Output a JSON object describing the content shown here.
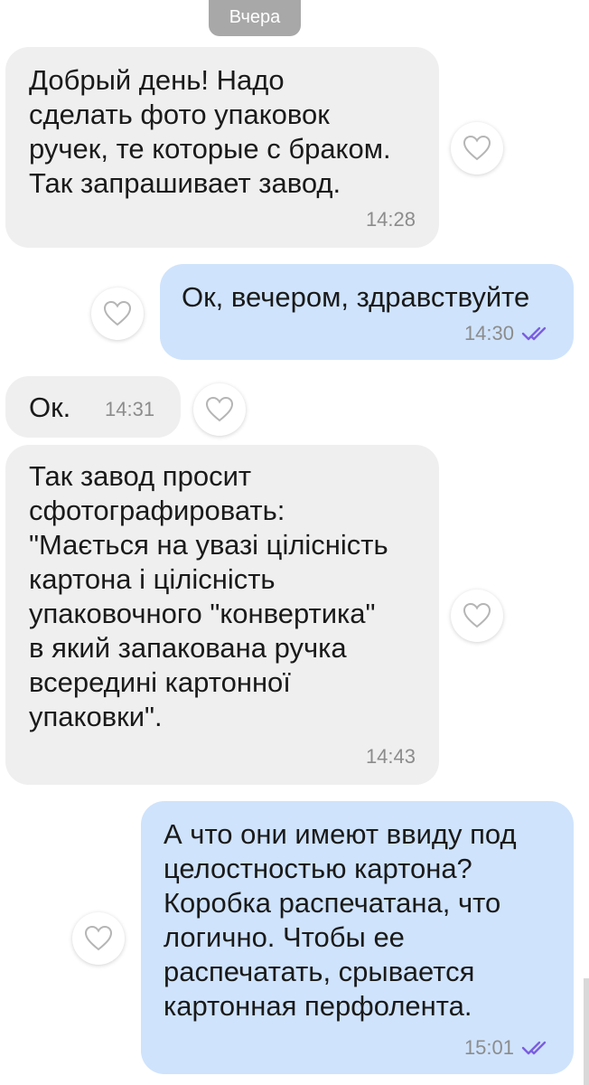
{
  "date_separator": "Вчера",
  "messages": [
    {
      "direction": "incoming",
      "text": "Добрый день! Надо\nсделать фото упаковок\nручек, те которые с браком.\nТак запрашивает завод.",
      "time": "14:28",
      "icon": "heart-outline"
    },
    {
      "direction": "outgoing",
      "text": "Ок, вечером, здравствуйте",
      "time": "14:30",
      "status_icon": "double-check",
      "icon": "heart-outline"
    },
    {
      "direction": "incoming",
      "text": "Ок.",
      "time": "14:31",
      "icon": "heart-outline"
    },
    {
      "direction": "incoming",
      "text": "Так завод просит\nсфотографировать:\n\"Мається на увазі цілісність\nкартона і цілісність\nупаковочного \"конвертика\"\nв який запакована ручка\nвсередині картонної\nупаковки\".",
      "time": "14:43",
      "icon": "heart-outline"
    },
    {
      "direction": "outgoing",
      "text": "А что они имеют ввиду под\nцелостностью картона?\nКоробка распечатана, что\nлогично. Чтобы ее\nраспечатать, срывается\nкартонная перфолента.",
      "time": "15:01",
      "status_icon": "double-check",
      "icon": "heart-outline"
    }
  ],
  "colors": {
    "incoming_bubble": "#efefef",
    "outgoing_bubble": "#cfe3fc",
    "date_chip": "#a8a8a8",
    "read_ticks": "#7b5ee0",
    "timestamp": "#8c8c8c"
  }
}
